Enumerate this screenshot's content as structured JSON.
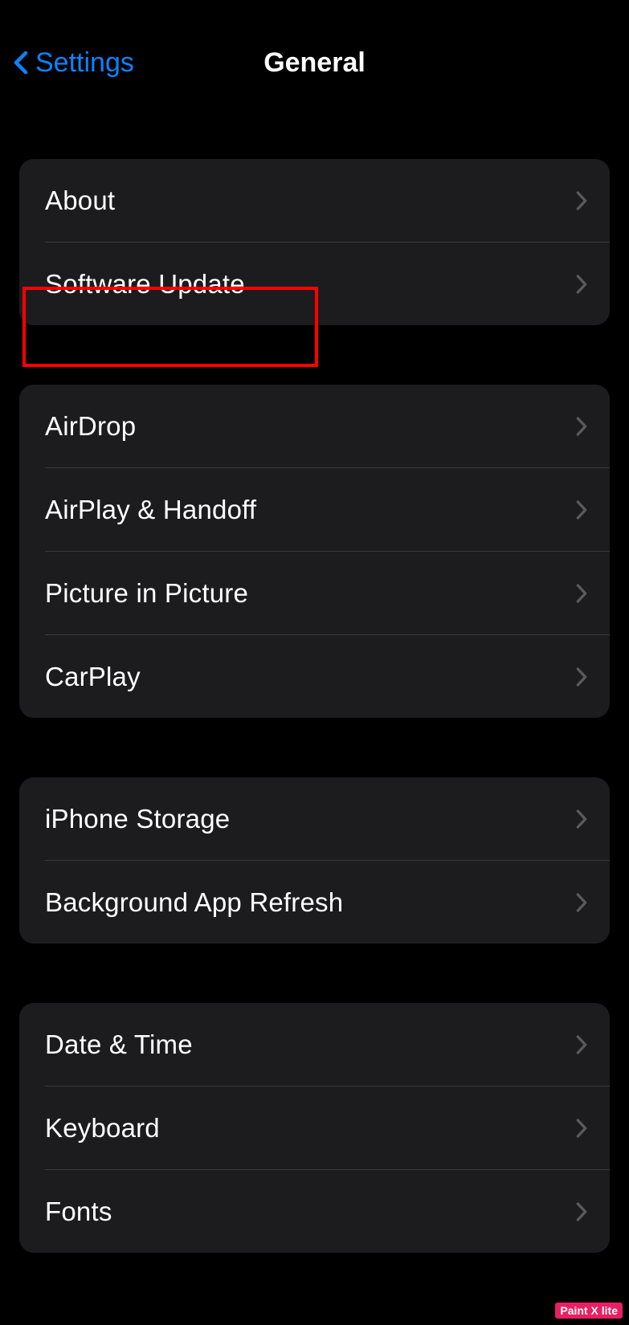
{
  "nav": {
    "back_label": "Settings",
    "title": "General"
  },
  "groups": [
    {
      "items": [
        {
          "label": "About",
          "name": "row-about"
        },
        {
          "label": "Software Update",
          "name": "row-software-update"
        }
      ]
    },
    {
      "items": [
        {
          "label": "AirDrop",
          "name": "row-airdrop"
        },
        {
          "label": "AirPlay & Handoff",
          "name": "row-airplay-handoff"
        },
        {
          "label": "Picture in Picture",
          "name": "row-picture-in-picture"
        },
        {
          "label": "CarPlay",
          "name": "row-carplay"
        }
      ]
    },
    {
      "items": [
        {
          "label": "iPhone Storage",
          "name": "row-iphone-storage"
        },
        {
          "label": "Background App Refresh",
          "name": "row-background-app-refresh"
        }
      ]
    },
    {
      "items": [
        {
          "label": "Date & Time",
          "name": "row-date-time"
        },
        {
          "label": "Keyboard",
          "name": "row-keyboard"
        },
        {
          "label": "Fonts",
          "name": "row-fonts"
        }
      ]
    }
  ],
  "watermark": "Paint X lite",
  "colors": {
    "accent": "#0a84ff",
    "highlight": "#ff0000"
  }
}
